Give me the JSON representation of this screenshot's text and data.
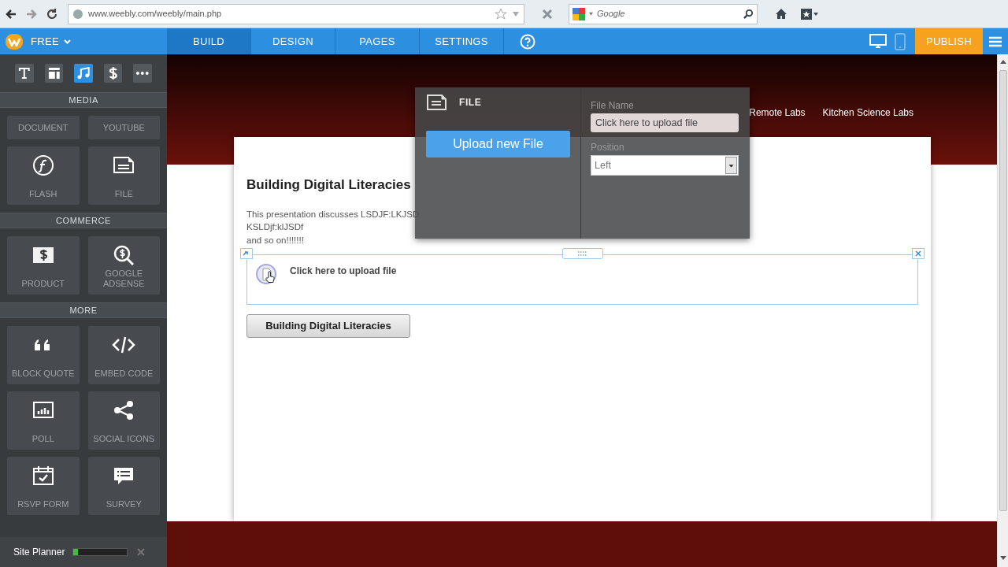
{
  "browser": {
    "url": "www.weebly.com/weebly/main.php",
    "search_placeholder": "Google"
  },
  "app_bar": {
    "plan": "FREE",
    "tabs": [
      {
        "label": "BUILD",
        "selected": true
      },
      {
        "label": "DESIGN",
        "selected": false
      },
      {
        "label": "PAGES",
        "selected": false
      },
      {
        "label": "SETTINGS",
        "selected": false
      }
    ],
    "views": [
      {
        "kind": "desktop",
        "selected": true
      },
      {
        "kind": "mobile",
        "selected": false
      }
    ],
    "publish": "PUBLISH"
  },
  "sidebar": {
    "tools": [
      {
        "kind": "text",
        "selected": false
      },
      {
        "kind": "layout",
        "selected": false
      },
      {
        "kind": "media",
        "selected": true
      },
      {
        "kind": "commerce",
        "selected": false
      },
      {
        "kind": "more",
        "selected": false
      }
    ],
    "sections": [
      {
        "title": "MEDIA",
        "items": [
          {
            "label": "DOCUMENT",
            "kind": "clipped"
          },
          {
            "label": "YOUTUBE",
            "kind": "clipped"
          },
          {
            "label": "FLASH",
            "kind": "flash"
          },
          {
            "label": "FILE",
            "kind": "file"
          }
        ]
      },
      {
        "title": "COMMERCE",
        "items": [
          {
            "label": "PRODUCT",
            "kind": "product"
          },
          {
            "label": "GOOGLE ADSENSE",
            "kind": "adsense"
          }
        ]
      },
      {
        "title": "MORE",
        "items": [
          {
            "label": "BLOCK QUOTE",
            "kind": "quote"
          },
          {
            "label": "EMBED CODE",
            "kind": "embed"
          },
          {
            "label": "POLL",
            "kind": "poll"
          },
          {
            "label": "SOCIAL ICONS",
            "kind": "social"
          },
          {
            "label": "RSVP FORM",
            "kind": "rsvp"
          },
          {
            "label": "SURVEY",
            "kind": "survey"
          }
        ]
      }
    ],
    "site_planner": {
      "label": "Site Planner",
      "level": 0.08
    }
  },
  "site_nav": [
    "Remote Labs",
    "Kitchen Science Labs"
  ],
  "page": {
    "title": "Building Digital Literacies",
    "paragraph_lines": [
      "This presentation discusses LSDJF:LKJSD",
      "KSLDjf:klJSDf",
      "and so on!!!!!!!"
    ],
    "file_element": {
      "label": "Click here to upload file"
    },
    "button": "Building Digital Literacies"
  },
  "file_panel": {
    "title": "FILE",
    "upload_button": "Upload new File",
    "fields": [
      {
        "kind": "text",
        "label": "File Name",
        "value": "Click here to upload file"
      },
      {
        "kind": "select",
        "label": "Position",
        "value": "Left"
      }
    ]
  }
}
